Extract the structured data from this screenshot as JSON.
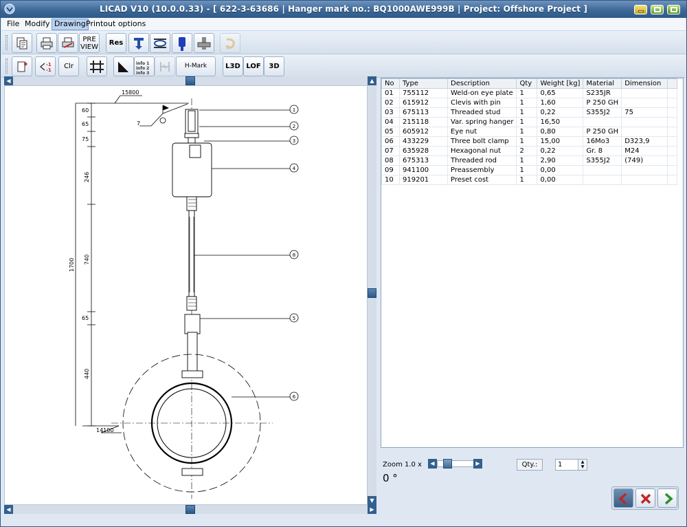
{
  "window": {
    "title": "LICAD V10 (10.0.0.33) -  [ 622-3-63686 | Hanger mark no.: BQ1000AWE999B | Project: Offshore Project ]"
  },
  "menu": {
    "items": [
      {
        "label": "File"
      },
      {
        "label": "Modify"
      },
      {
        "label": "Drawing"
      },
      {
        "label": "Printout options"
      }
    ]
  },
  "toolbar1": {
    "preview_label_1": "PRE",
    "preview_label_2": "VIEW",
    "res_label": "Res"
  },
  "toolbar2": {
    "clr_label": "Clr",
    "info_label": "info",
    "hmark_label": "H-Mark",
    "l3d_label": "L3D",
    "lof_label": "LOF",
    "three_d_label": "3D"
  },
  "drawing": {
    "dims_top": "15800",
    "dims_bottom": "14100",
    "total": "1700",
    "segments": [
      "60",
      "65",
      "75",
      "246",
      "740",
      "65",
      "440"
    ],
    "flag_label": "7",
    "callouts": [
      "1",
      "2",
      "3",
      "4",
      "8",
      "5",
      "6"
    ]
  },
  "parts_table": {
    "headers": [
      "No",
      "Type",
      "Description",
      "Qty",
      "Weight [kg]",
      "Material",
      "Dimension"
    ],
    "rows": [
      [
        "01",
        "755112",
        "Weld-on eye plate",
        "1",
        "0,65",
        "S235JR",
        ""
      ],
      [
        "02",
        "615912",
        "Clevis with pin",
        "1",
        "1,60",
        "P 250 GH",
        ""
      ],
      [
        "03",
        "675113",
        "Threaded stud",
        "1",
        "0,22",
        "S355J2",
        "75"
      ],
      [
        "04",
        "215118",
        "Var. spring hanger",
        "1",
        "16,50",
        "",
        ""
      ],
      [
        "05",
        "605912",
        "Eye nut",
        "1",
        "0,80",
        "P 250 GH",
        ""
      ],
      [
        "06",
        "433229",
        "Three bolt clamp",
        "1",
        "15,00",
        "16Mo3",
        "D323,9"
      ],
      [
        "07",
        "635928",
        "Hexagonal nut",
        "2",
        "0,22",
        "Gr. 8",
        "M24"
      ],
      [
        "08",
        "675313",
        "Threaded rod",
        "1",
        "2,90",
        "S355J2",
        "(749)"
      ],
      [
        "09",
        "941100",
        "Preassembly",
        "1",
        "0,00",
        "",
        ""
      ],
      [
        "10",
        "919201",
        "Preset cost",
        "1",
        "0,00",
        "",
        ""
      ]
    ]
  },
  "controls": {
    "zoom_label": "Zoom 1.0 x",
    "angle": "0 °",
    "qty_label": "Qty.:",
    "qty_value": "1"
  },
  "colors": {
    "title_bar": "#3d6897",
    "window_bg": "#dfe8f2",
    "back_button": "#3a5f88",
    "cancel_red": "#c0282a",
    "ok_green": "#2f8f2f"
  }
}
